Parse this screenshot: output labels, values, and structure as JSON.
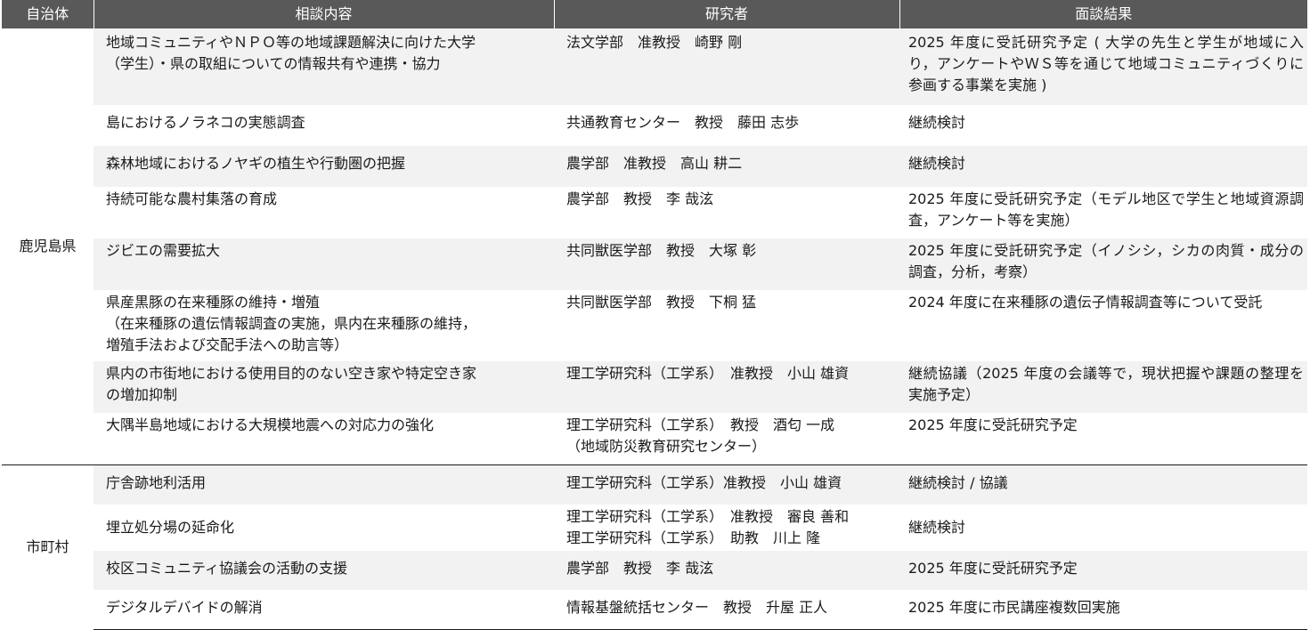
{
  "headers": {
    "municipality": "自治体",
    "topic": "相談内容",
    "researcher": "研究者",
    "result": "面談結果"
  },
  "groups": [
    {
      "municipality": "鹿児島県",
      "rows": [
        {
          "topic": "地域コミュニティやＮＰＯ等の地域課題解決に向けた大学\n（学生）・県の取組についての情報共有や連携・協力",
          "researcher": "法文学部　准教授　崎野 剛",
          "result": "2025 年度に受託研究予定 ( 大学の先生と学生が地域に入り，アンケートやＷＳ等を通じて地域コミュニティづくりに参画する事業を実施 )"
        },
        {
          "topic": "島におけるノラネコの実態調査",
          "researcher": "共通教育センター　教授　藤田 志歩",
          "result": "継続検討"
        },
        {
          "topic": "森林地域におけるノヤギの植生や行動圏の把握",
          "researcher": "農学部　准教授　高山 耕二",
          "result": "継続検討"
        },
        {
          "topic": "持続可能な農村集落の育成",
          "researcher": "農学部　教授　李 哉泫",
          "result": "2025 年度に受託研究予定（モデル地区で学生と地域資源調査，アンケート等を実施）"
        },
        {
          "topic": "ジビエの需要拡大",
          "researcher": "共同獣医学部　教授　大塚 彰",
          "result": "2025 年度に受託研究予定（イノシシ，シカの肉質・成分の調査，分析，考察）"
        },
        {
          "topic": "県産黒豚の在来種豚の維持・増殖\n（在来種豚の遺伝情報調査の実施，県内在来種豚の維持，\n増殖手法および交配手法への助言等）",
          "researcher": "共同獣医学部　教授　下桐 猛",
          "result": "2024 年度に在来種豚の遺伝子情報調査等について受託"
        },
        {
          "topic": "県内の市街地における使用目的のない空き家や特定空き家\nの増加抑制",
          "researcher": "理工学研究科（工学系）　准教授　小山 雄資",
          "result": "継続協議（2025 年度の会議等で，現状把握や課題の整理を実施予定）"
        },
        {
          "topic": "大隅半島地域における大規模地震への対応力の強化",
          "researcher": "理工学研究科（工学系）　教授　酒匂 一成\n（地域防災教育研究センター）",
          "result": "2025 年度に受託研究予定"
        }
      ]
    },
    {
      "municipality": "市町村",
      "rows": [
        {
          "topic": "庁舎跡地利活用",
          "researcher": "理工学研究科（工学系）准教授　小山 雄資",
          "result": "継続検討 / 協議"
        },
        {
          "topic": "埋立処分場の延命化",
          "researcher": "理工学研究科（工学系）　准教授　審良 善和\n理工学研究科（工学系）　助教　川上 隆",
          "result": "継続検討"
        },
        {
          "topic": "校区コミュニティ協議会の活動の支援",
          "researcher": "農学部　教授　李 哉泫",
          "result": "2025 年度に受託研究予定"
        },
        {
          "topic": "デジタルデバイドの解消",
          "researcher": "情報基盤統括センター　教授　升屋 正人",
          "result": "2025 年度に市民講座複数回実施"
        }
      ]
    }
  ]
}
